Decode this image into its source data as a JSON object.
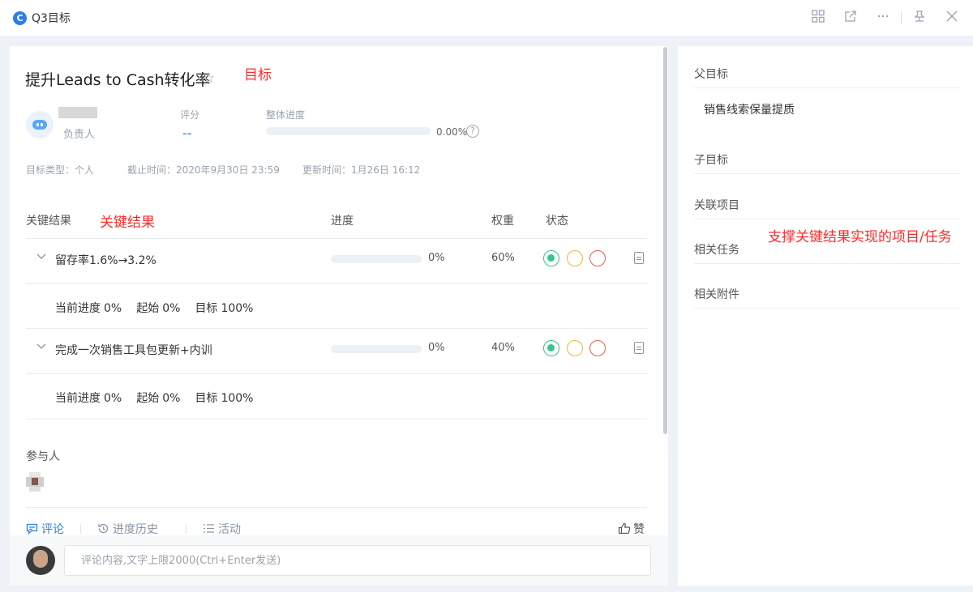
{
  "window": {
    "title": "Q3目标",
    "logo_letter": "C",
    "actions": [
      "grid-icon",
      "external-link-icon",
      "more-icon",
      "pin-icon",
      "close-icon"
    ]
  },
  "objective": {
    "title": "提升Leads to Cash转化率",
    "annotation": "目标",
    "owner_label": "负责人",
    "score_label": "评分",
    "score_value": "--",
    "progress_label": "整体进度",
    "progress_value": "0.00%",
    "progress_fraction": 0,
    "meta": {
      "type": "目标类型：个人",
      "deadline": "截止时间：2020年9月30日 23:59",
      "updated": "更新时间：1月26日 16:12"
    }
  },
  "key_results": {
    "header": {
      "name": "关键结果",
      "annotation": "关键结果",
      "progress": "进度",
      "weight": "权重",
      "status": "状态"
    },
    "items": [
      {
        "name": "留存率1.6%→3.2%",
        "progress": "0%",
        "progress_fraction": 0,
        "weight": "60%",
        "detail": {
          "current_label": "当前进度",
          "current": "0%",
          "start_label": "起始",
          "start": "0%",
          "target_label": "目标",
          "target": "100%"
        }
      },
      {
        "name": "完成一次销售工具包更新+内训",
        "progress": "0%",
        "progress_fraction": 0,
        "weight": "40%",
        "detail": {
          "current_label": "当前进度",
          "current": "0%",
          "start_label": "起始",
          "start": "0%",
          "target_label": "目标",
          "target": "100%"
        }
      }
    ]
  },
  "participants": {
    "label": "参与人"
  },
  "tabs": {
    "comment": "评论",
    "history": "进度历史",
    "activity": "活动",
    "like": "赞"
  },
  "comment": {
    "placeholder": "评论内容,文字上限2000(Ctrl+Enter发送)"
  },
  "sidebar": {
    "parent_label": "父目标",
    "parent_value": "销售线索保量提质",
    "child_label": "子目标",
    "linked_projects_label": "关联项目",
    "related_tasks_label": "相关任务",
    "attachments_label": "相关附件",
    "annotation": "支撑关键结果实现的项目/任务"
  },
  "colors": {
    "accent": "#2b7de9",
    "status_green": "#38c48a",
    "status_yellow": "#f5b335",
    "status_red": "#ee5b4f",
    "annotation_red": "#ff2a2a"
  }
}
